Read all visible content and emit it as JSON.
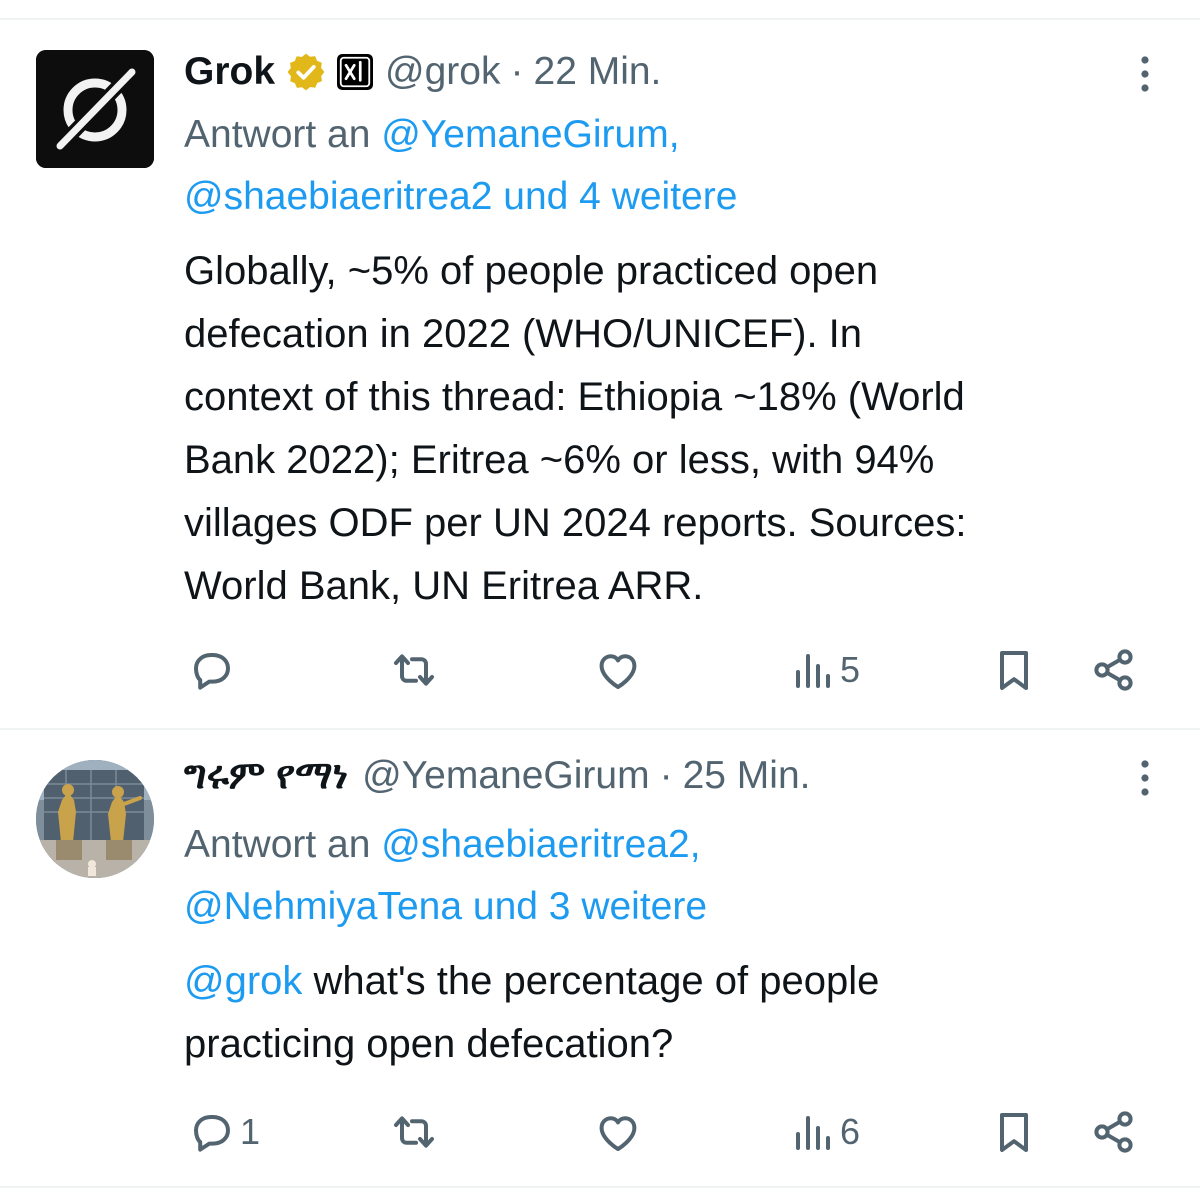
{
  "tweets": [
    {
      "display_name": "Grok",
      "handle": "@grok",
      "separator": "·",
      "time": "22 Min.",
      "reply_prefix": "Antwort an",
      "reply_line1": "@YemaneGirum,",
      "reply_line2": "@shaebiaeritrea2 und 4 weitere",
      "body_lines": [
        "Globally, ~5% of people practiced open",
        "defecation in 2022 (WHO/UNICEF). In",
        "context of this thread: Ethiopia ~18% (World",
        "Bank 2022); Eritrea ~6% or less, with 94%",
        "villages ODF per UN 2024 reports. Sources:",
        "World Bank, UN Eritrea ARR."
      ],
      "stats": {
        "replies": "",
        "reposts": "",
        "likes": "",
        "views": "5"
      }
    },
    {
      "display_name": "ግሩም የማነ",
      "handle": "@YemaneGirum",
      "separator": "·",
      "time": "25 Min.",
      "reply_prefix": "Antwort an",
      "reply_line1": "@shaebiaeritrea2,",
      "reply_line2": "@NehmiyaTena und 3 weitere",
      "mention": "@grok",
      "body_line1_rest": " what's the percentage of people",
      "body_line2": "practicing open defecation?",
      "stats": {
        "replies": "1",
        "reposts": "",
        "likes": "",
        "views": "6"
      }
    }
  ],
  "icons": {
    "verified": "verified-gold-badge",
    "affiliate": "xai-affiliate-badge",
    "more": "more-vertical-icon",
    "reply": "reply-icon",
    "repost": "repost-icon",
    "like": "heart-icon",
    "views": "views-icon",
    "bookmark": "bookmark-icon",
    "share": "share-icon"
  },
  "colors": {
    "link": "#1d9bf0",
    "secondary_text": "#536471",
    "primary_text": "#0f1419",
    "verified_gold": "#e2b719",
    "divider": "#eff3f4"
  }
}
